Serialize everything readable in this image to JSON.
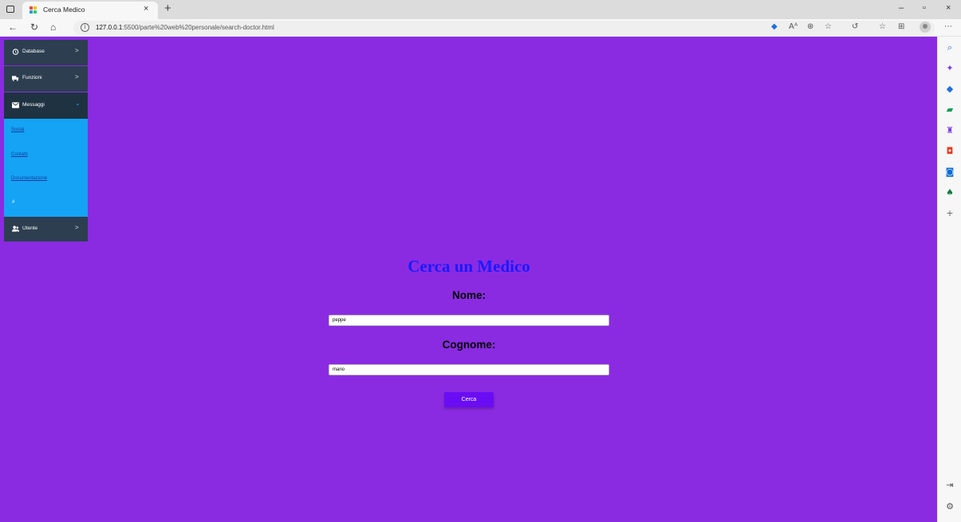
{
  "browser": {
    "tab_title": "Cerca Medico",
    "tab_close": "×",
    "new_tab": "+",
    "url_prefix": "127.0.0.1",
    "url_rest": ":5500/parte%20web%20personale/search-doctor.html",
    "window_controls": [
      "–",
      "▫",
      "×"
    ],
    "nav_icons": [
      "back-icon",
      "refresh-icon",
      "home-icon"
    ],
    "toolbar_icons": [
      "tag-icon",
      "read-aloud-icon",
      "zoom-icon",
      "favorite-add-icon",
      "extensions-icon",
      "favorites-icon",
      "collections-icon",
      "profile-icon",
      "more-icon"
    ]
  },
  "edge_sidebar": {
    "icons": [
      "search-icon",
      "copilot-icon",
      "shopping-icon",
      "tools-icon",
      "games-icon",
      "office-icon",
      "outlook-icon",
      "tree-icon",
      "add-icon",
      "split-screen-icon",
      "settings-icon"
    ]
  },
  "colors": {
    "page_bg": "#8a2be2",
    "menu_bg": "#2c3e50",
    "submenu_bg": "#14a3f5",
    "title_color": "#1a1aff",
    "button_bg": "#6a0df5"
  },
  "menu": {
    "items": [
      {
        "label": "Database",
        "icon": "database-icon",
        "arrow": ">"
      },
      {
        "label": "Funzioni",
        "icon": "truck-icon",
        "arrow": ">"
      },
      {
        "label": "Messaggi",
        "icon": "mail-icon",
        "arrow": "⌄"
      },
      {
        "label": "Utente",
        "icon": "users-icon",
        "arrow": ">"
      }
    ],
    "submenu": [
      "Social",
      "Contatti",
      "Documentazione",
      "#"
    ]
  },
  "form": {
    "title": "Cerca un Medico",
    "nome_label": "Nome:",
    "nome_value": "peppe",
    "cognome_label": "Cognome:",
    "cognome_value": "mario",
    "submit_label": "Cerca"
  }
}
